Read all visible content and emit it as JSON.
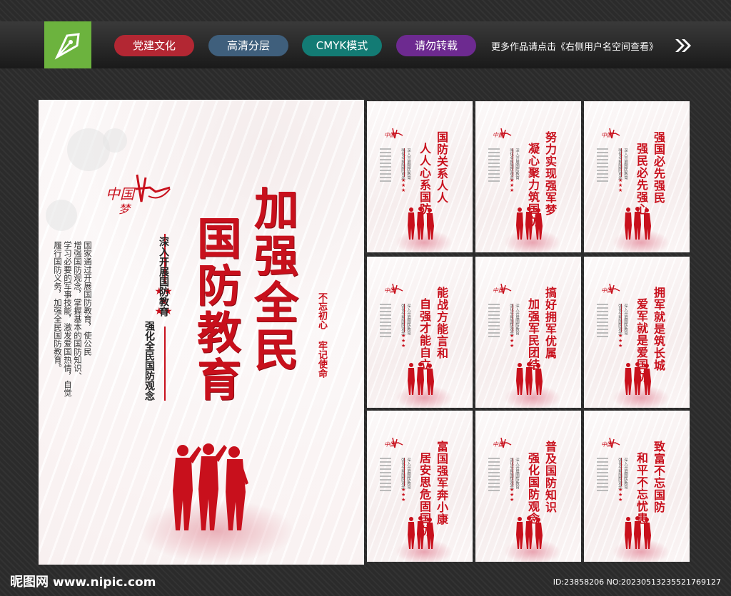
{
  "header": {
    "tags": [
      {
        "label": "党建文化",
        "color": "#b32733"
      },
      {
        "label": "高清分层",
        "color": "#3f5f7c"
      },
      {
        "label": "CMYK模式",
        "color": "#137b74"
      },
      {
        "label": "请勿转载",
        "color": "#6d2a90"
      }
    ],
    "more_text": "更多作品请点击《右侧用户名空间查看》",
    "logo_icon": "pen-nib-icon",
    "arrow_icon": "double-chevron-right-icon"
  },
  "main_poster": {
    "title_line1": "加强全民",
    "title_line2": "国防教育",
    "subtitle_line1": "深入开展国防教育",
    "subtitle_line2": "强化全民国防观念",
    "body_lines": [
      "国家通过开展国防教育，使公民",
      "增强国防观念，掌握基本的国防知识、",
      "学习必要的军事技能，激发爱国热情，自觉",
      "履行国防义务，加强全民国防教育。"
    ],
    "slogan_1": "不忘初心",
    "slogan_2": "牢记使命",
    "logo_text": "中国梦",
    "accent_color": "#c8101c"
  },
  "small_posters": [
    {
      "line1": "国防关系人人",
      "line2": "人人心系国防"
    },
    {
      "line1": "努力实现强军梦",
      "line2": "凝心聚力筑国防"
    },
    {
      "line1": "强国必先强民",
      "line2": "强民必先强心"
    },
    {
      "line1": "能战方能言和",
      "line2": "自强才能自立"
    },
    {
      "line1": "搞好拥军优属",
      "line2": "加强军民团结"
    },
    {
      "line1": "拥军就是筑长城",
      "line2": "爱军就是爱国防"
    },
    {
      "line1": "富国强军奔小康",
      "line2": "居安思危固国防"
    },
    {
      "line1": "普及国防知识",
      "line2": "强化国防观念"
    },
    {
      "line1": "致富不忘国防",
      "line2": "和平不忘忧患"
    }
  ],
  "footer": {
    "site_name": "昵图网",
    "site_url": "www.nipic.com",
    "id_text": "ID:23858206 NO:20230513235521769127"
  }
}
